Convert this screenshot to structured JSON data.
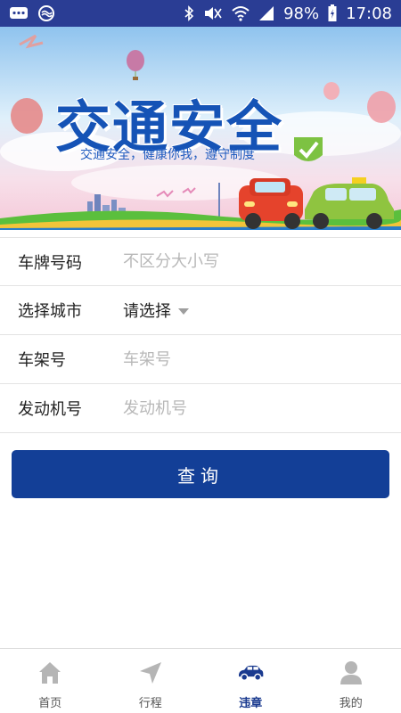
{
  "status_bar": {
    "battery": "98%",
    "time": "17:08",
    "icons": [
      "chat-icon",
      "sync-icon",
      "bluetooth-icon",
      "mute-icon",
      "wifi-icon",
      "signal-icon",
      "battery-icon"
    ]
  },
  "banner": {
    "title": "交通安全",
    "slogan": "交通安全，健康你我，遵守制度"
  },
  "form": {
    "plate": {
      "label": "车牌号码",
      "placeholder": "不区分大小写"
    },
    "city": {
      "label": "选择城市",
      "value": "请选择"
    },
    "frame": {
      "label": "车架号",
      "placeholder": "车架号"
    },
    "engine": {
      "label": "发动机号",
      "placeholder": "发动机号"
    }
  },
  "query_label": "查询",
  "nav": {
    "home": "首页",
    "trip": "行程",
    "violation": "违章",
    "mine": "我的"
  },
  "colors": {
    "status_bar": "#2a3d94",
    "primary": "#133f97",
    "active_nav": "#1a3a8f",
    "inactive_icon": "#b5b5b5"
  }
}
